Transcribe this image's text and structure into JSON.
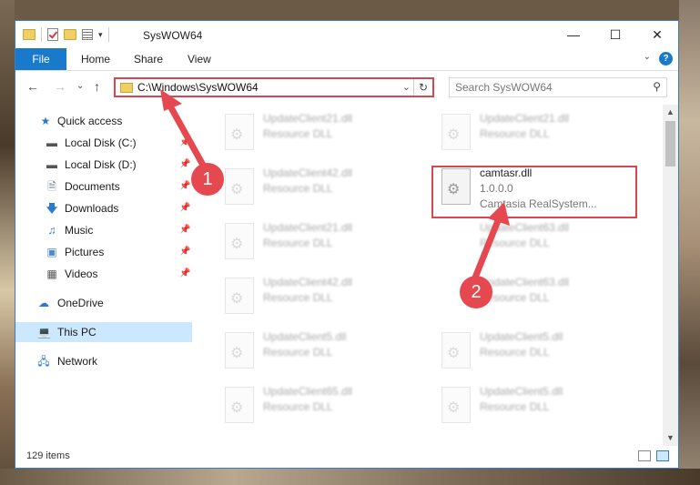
{
  "window": {
    "title": "SysWOW64",
    "buttons": {
      "minimize": "—",
      "maximize": "☐",
      "close": "✕"
    }
  },
  "ribbon": {
    "file": "File",
    "tabs": [
      "Home",
      "Share",
      "View"
    ],
    "help": "?"
  },
  "nav": {
    "back": "←",
    "forward": "→",
    "recent": "⌄",
    "up": "↑",
    "address": "C:\\Windows\\SysWOW64",
    "search_placeholder": "Search SysWOW64"
  },
  "sidebar": {
    "items": [
      {
        "label": "Quick access",
        "icon": "star-icon"
      },
      {
        "label": "Local Disk (C:)",
        "icon": "drive-icon"
      },
      {
        "label": "Local Disk (D:)",
        "icon": "drive-icon"
      },
      {
        "label": "Documents",
        "icon": "documents-icon"
      },
      {
        "label": "Downloads",
        "icon": "download-icon"
      },
      {
        "label": "Music",
        "icon": "music-icon"
      },
      {
        "label": "Pictures",
        "icon": "pictures-icon"
      },
      {
        "label": "Videos",
        "icon": "videos-icon"
      },
      {
        "label": "OneDrive",
        "icon": "cloud-icon"
      },
      {
        "label": "This PC",
        "icon": "computer-icon"
      },
      {
        "label": "Network",
        "icon": "network-icon"
      }
    ]
  },
  "files": {
    "left": [
      {
        "name": "UpdateClient21.dll",
        "type": "Resource DLL"
      },
      {
        "name": "UpdateClient42.dll",
        "type": "Resource DLL"
      },
      {
        "name": "UpdateClient21.dll",
        "type": "Resource DLL"
      },
      {
        "name": "UpdateClient42.dll",
        "type": "Resource DLL"
      },
      {
        "name": "UpdateClient5.dll",
        "type": "Resource DLL"
      },
      {
        "name": "UpdateClient65.dll",
        "type": "Resource DLL"
      }
    ],
    "right": [
      {
        "name": "UpdateClient21.dll",
        "type": "Resource DLL"
      },
      {
        "name": "UpdateClient63.dll",
        "type": "Resource DLL"
      },
      {
        "name": "UpdateClient63.dll",
        "type": "Resource DLL"
      },
      {
        "name": "UpdateClient5.dll",
        "type": "Resource DLL"
      },
      {
        "name": "UpdateClient5.dll",
        "type": "Resource DLL"
      }
    ],
    "highlighted": {
      "name": "camtasr.dll",
      "version": "1.0.0.0",
      "description": "Camtasia RealSystem..."
    }
  },
  "status": {
    "count": "129 items"
  },
  "annotations": {
    "badge1": "1",
    "badge2": "2",
    "color": "#e5484f"
  }
}
